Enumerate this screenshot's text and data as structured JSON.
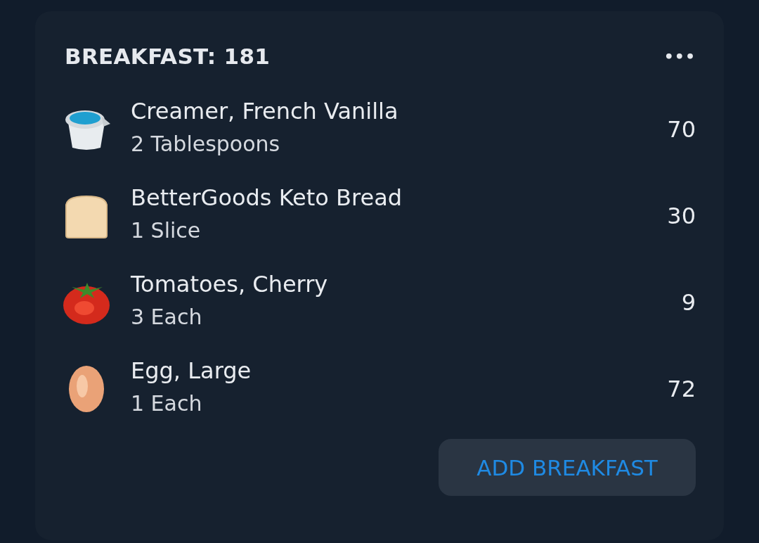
{
  "meal": {
    "title": "BREAKFAST: 181",
    "more": "•••",
    "items": [
      {
        "kind": "creamer",
        "name": "Creamer, French Vanilla",
        "serving": "2 Tablespoons",
        "calories": "70"
      },
      {
        "kind": "bread",
        "name": "BetterGoods Keto Bread",
        "serving": "1 Slice",
        "calories": "30"
      },
      {
        "kind": "tomato",
        "name": "Tomatoes, Cherry",
        "serving": "3 Each",
        "calories": "9"
      },
      {
        "kind": "egg",
        "name": "Egg, Large",
        "serving": "1 Each",
        "calories": "72"
      }
    ],
    "button": "ADD BREAKFAST"
  }
}
